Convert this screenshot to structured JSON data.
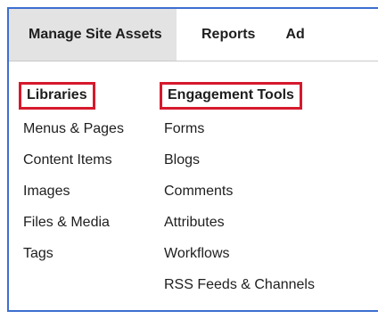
{
  "nav": {
    "tabs": [
      {
        "label": "Manage Site Assets",
        "active": true
      },
      {
        "label": "Reports",
        "active": false
      },
      {
        "label": "Ad",
        "active": false
      }
    ]
  },
  "libraries": {
    "header": "Libraries",
    "items": [
      "Menus & Pages",
      "Content Items",
      "Images",
      "Files & Media",
      "Tags"
    ]
  },
  "engagement": {
    "header": "Engagement Tools",
    "items": [
      "Forms",
      "Blogs",
      "Comments",
      "Attributes",
      "Workflows",
      "RSS Feeds & Channels"
    ]
  },
  "colors": {
    "frame_border": "#3c6fd1",
    "highlight_box": "#d6192c",
    "active_tab_bg": "#e3e3e3"
  }
}
